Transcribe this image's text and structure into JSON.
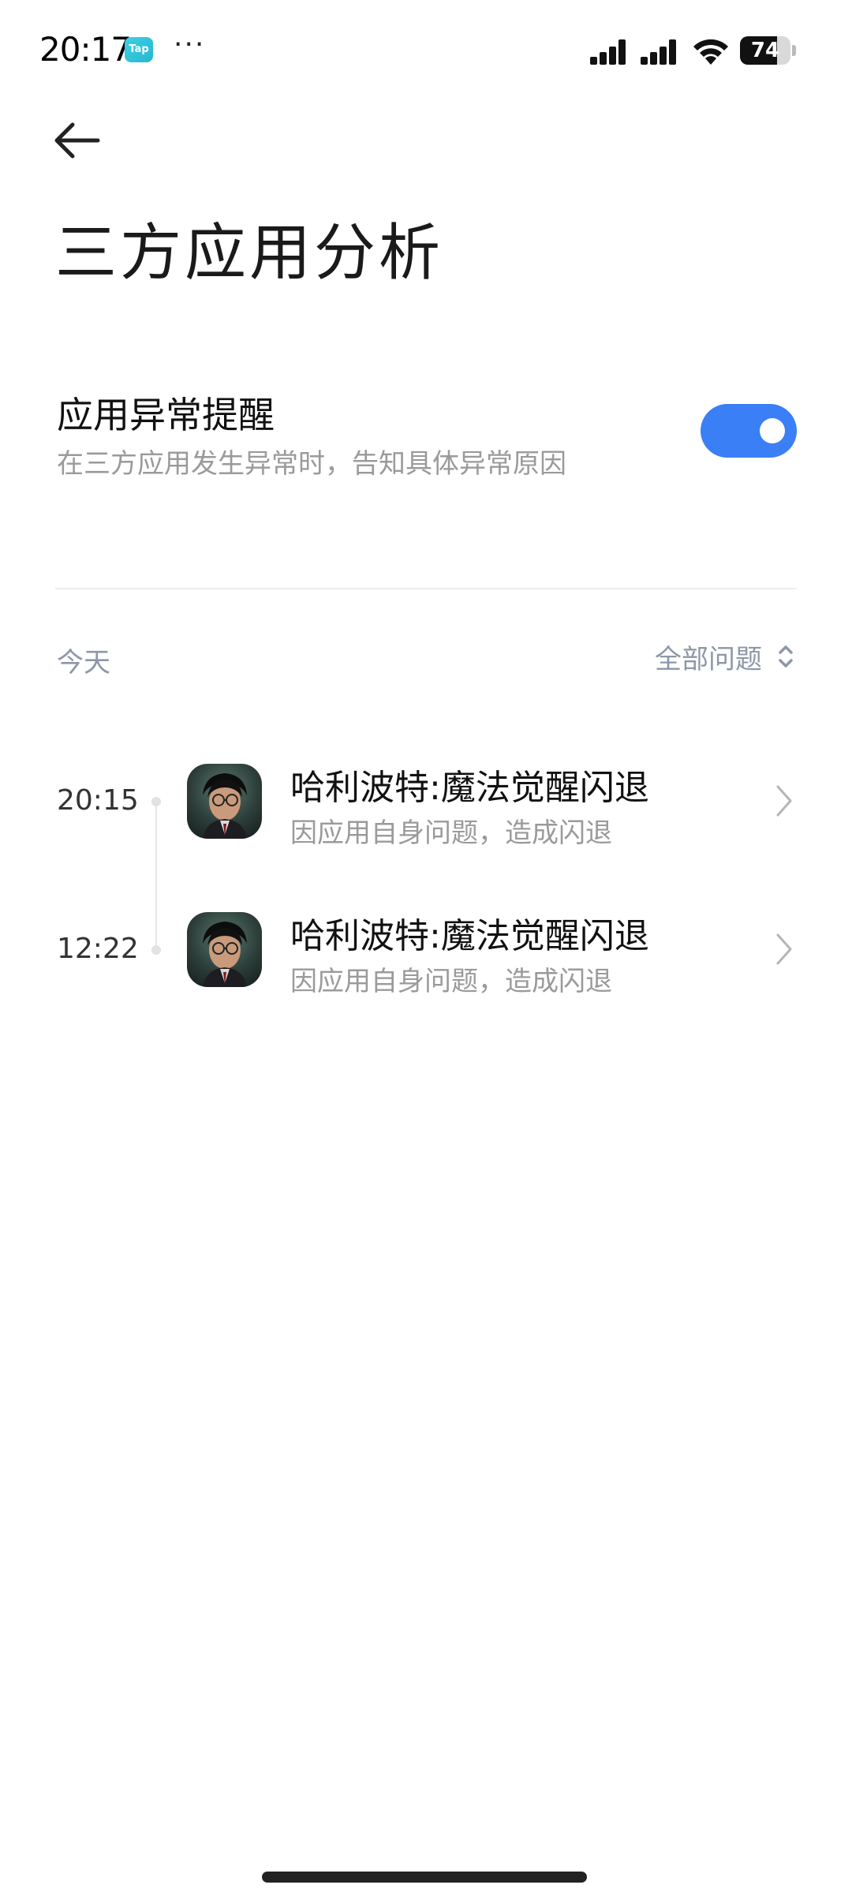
{
  "status_bar": {
    "time": "20:17",
    "tap_badge": "Tap",
    "more": "···",
    "battery_level": "74",
    "battery_percent": 74
  },
  "header": {
    "title": "三方应用分析"
  },
  "setting": {
    "title": "应用异常提醒",
    "description": "在三方应用发生异常时，告知具体异常原因",
    "enabled": true,
    "accent_color": "#3a7ff5"
  },
  "list_header": {
    "date": "今天",
    "filter_label": "全部问题"
  },
  "logs": [
    {
      "time": "20:15",
      "title": "哈利波特:魔法觉醒闪退",
      "subtitle": "因应用自身问题，造成闪退",
      "icon": "harry-potter-app-icon"
    },
    {
      "time": "12:22",
      "title": "哈利波特:魔法觉醒闪退",
      "subtitle": "因应用自身问题，造成闪退",
      "icon": "harry-potter-app-icon"
    }
  ]
}
